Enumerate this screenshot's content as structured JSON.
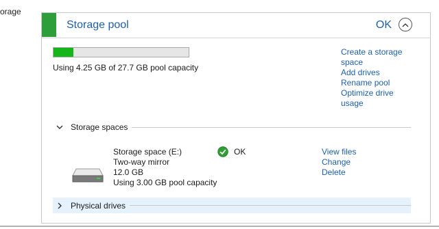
{
  "nav": {
    "fragment": "orage"
  },
  "panel": {
    "title": "Storage pool",
    "status": "OK",
    "progress_fraction": 0.145,
    "usage_text": "Using 4.25 GB of 27.7 GB pool capacity",
    "actions": [
      "Create a storage space",
      "Add drives",
      "Rename pool",
      "Optimize drive usage"
    ],
    "colors": {
      "accent_green": "#2e9e3a",
      "link_blue": "#1f5fa8",
      "progress_green": "#16b51c"
    }
  },
  "storage_spaces": {
    "label": "Storage spaces",
    "item": {
      "name": "Storage space (E:)",
      "resiliency": "Two-way mirror",
      "size": "12.0 GB",
      "usage": "Using 3.00 GB pool capacity",
      "status": "OK",
      "actions": [
        "View files",
        "Change",
        "Delete"
      ]
    }
  },
  "physical_drives": {
    "label": "Physical drives"
  }
}
